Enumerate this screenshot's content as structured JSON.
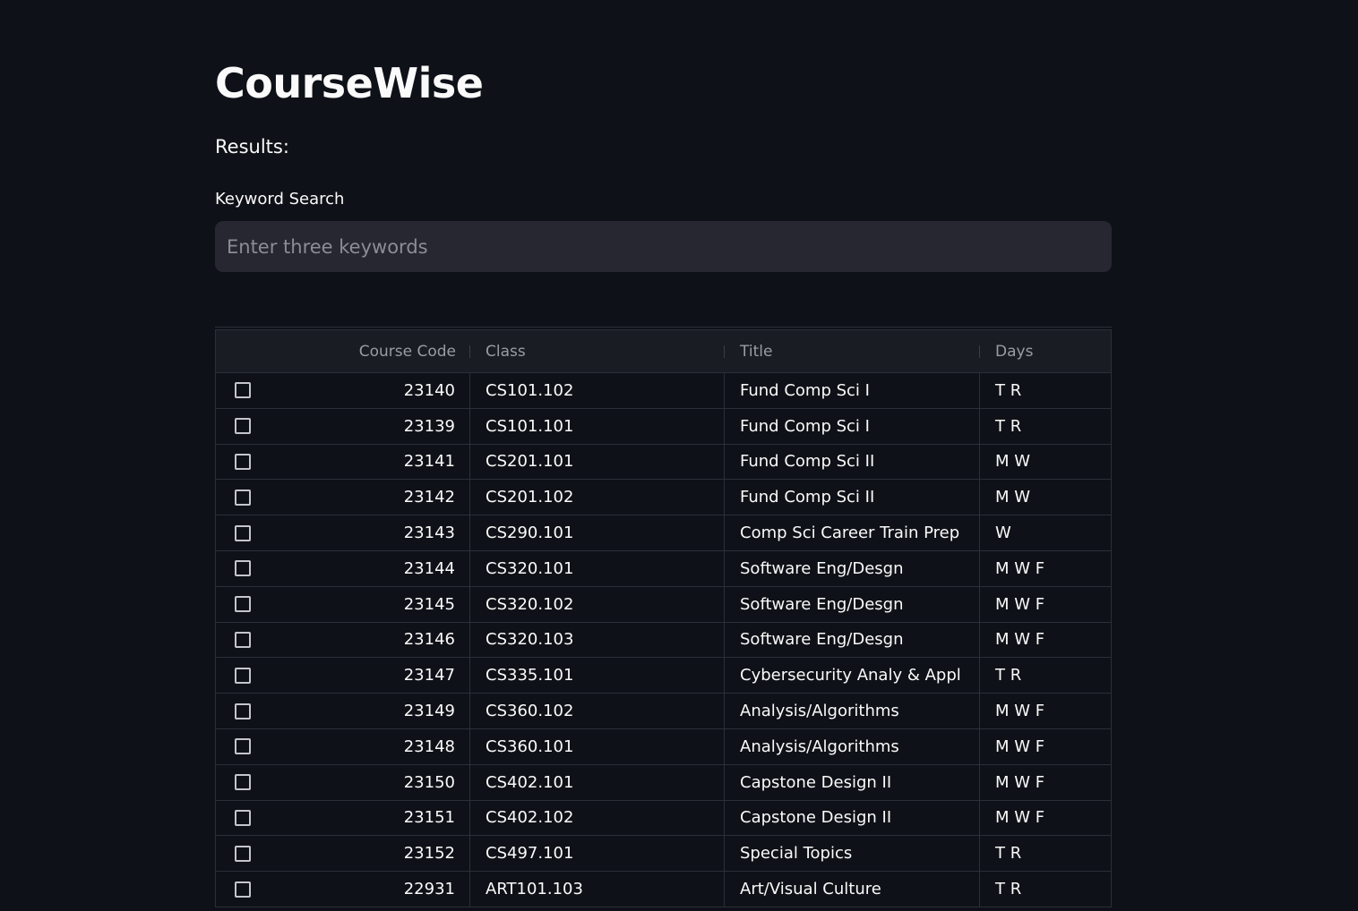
{
  "app": {
    "title": "CourseWise",
    "results_label": "Results:"
  },
  "search": {
    "label": "Keyword Search",
    "placeholder": "Enter three keywords",
    "value": ""
  },
  "table": {
    "columns": [
      "Course Code",
      "Class",
      "Title",
      "Days"
    ],
    "rows": [
      {
        "code": "23140",
        "class": "CS101.102",
        "title": "Fund Comp Sci I",
        "days": "T R"
      },
      {
        "code": "23139",
        "class": "CS101.101",
        "title": "Fund Comp Sci I",
        "days": "T R"
      },
      {
        "code": "23141",
        "class": "CS201.101",
        "title": "Fund Comp Sci II",
        "days": "M W"
      },
      {
        "code": "23142",
        "class": "CS201.102",
        "title": "Fund Comp Sci II",
        "days": "M W"
      },
      {
        "code": "23143",
        "class": "CS290.101",
        "title": "Comp Sci Career Train Prep",
        "days": "W"
      },
      {
        "code": "23144",
        "class": "CS320.101",
        "title": "Software Eng/Desgn",
        "days": "M W F"
      },
      {
        "code": "23145",
        "class": "CS320.102",
        "title": "Software Eng/Desgn",
        "days": "M W F"
      },
      {
        "code": "23146",
        "class": "CS320.103",
        "title": "Software Eng/Desgn",
        "days": "M W F"
      },
      {
        "code": "23147",
        "class": "CS335.101",
        "title": "Cybersecurity Analy & Appl",
        "days": "T R"
      },
      {
        "code": "23149",
        "class": "CS360.102",
        "title": "Analysis/Algorithms",
        "days": "M W F"
      },
      {
        "code": "23148",
        "class": "CS360.101",
        "title": "Analysis/Algorithms",
        "days": "M W F"
      },
      {
        "code": "23150",
        "class": "CS402.101",
        "title": "Capstone Design II",
        "days": "M W F"
      },
      {
        "code": "23151",
        "class": "CS402.102",
        "title": "Capstone Design II",
        "days": "M W F"
      },
      {
        "code": "23152",
        "class": "CS497.101",
        "title": "Special Topics",
        "days": "T R"
      },
      {
        "code": "22931",
        "class": "ART101.103",
        "title": "Art/Visual Culture",
        "days": "T R"
      }
    ]
  }
}
